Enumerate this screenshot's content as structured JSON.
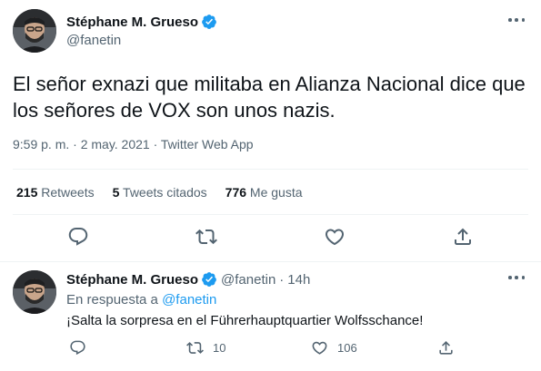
{
  "tweet": {
    "author_name": "Stéphane M. Grueso",
    "handle": "@fanetin",
    "text": "El señor exnazi que militaba en Alianza Nacional dice que los señores de VOX son unos nazis.",
    "timestamp": "9:59 p. m. · 2 may. 2021 · Twitter Web App",
    "stats": {
      "retweets_count": "215",
      "retweets_label": "Retweets",
      "quotes_count": "5",
      "quotes_label": "Tweets citados",
      "likes_count": "776",
      "likes_label": "Me gusta"
    },
    "actions": [
      "reply-icon",
      "retweet-icon",
      "like-icon",
      "share-icon"
    ]
  },
  "reply": {
    "author_name": "Stéphane M. Grueso",
    "handle": "@fanetin",
    "separator": "·",
    "time": "14h",
    "in_reply_to_label": "En respuesta a",
    "in_reply_to_handle": "@fanetin",
    "text": "¡Salta la sorpresa en el Führerhauptquartier Wolfsschance!",
    "retweets": "10",
    "likes": "106"
  },
  "colors": {
    "verified": "#1d9bf0",
    "link": "#1d9bf0",
    "secondary_text": "#536471",
    "primary_text": "#0f1419",
    "divider": "#eff3f4"
  }
}
